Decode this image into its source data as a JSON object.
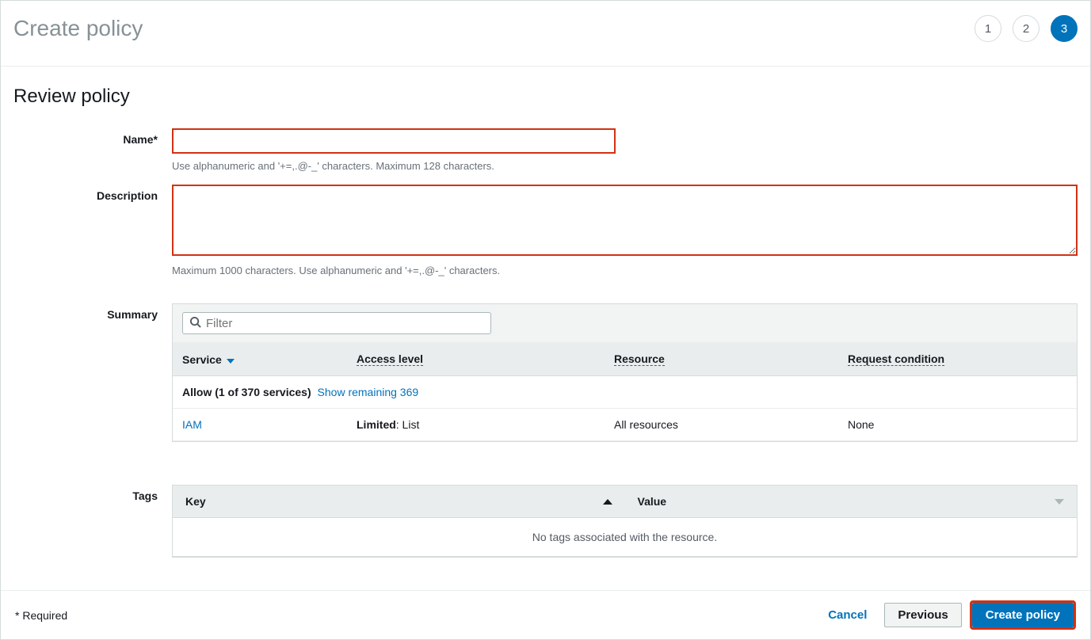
{
  "header": {
    "title": "Create policy",
    "steps": [
      "1",
      "2",
      "3"
    ],
    "active_step_index": 2
  },
  "section_title": "Review policy",
  "form": {
    "name_label": "Name*",
    "name_value": "",
    "name_hint": "Use alphanumeric and '+=,.@-_' characters. Maximum 128 characters.",
    "description_label": "Description",
    "description_value": "",
    "description_hint": "Maximum 1000 characters. Use alphanumeric and '+=,.@-_' characters."
  },
  "summary": {
    "label": "Summary",
    "filter_placeholder": "Filter",
    "columns": {
      "service": "Service",
      "access": "Access level",
      "resource": "Resource",
      "condition": "Request condition"
    },
    "allow_text": "Allow (1 of 370 services)",
    "show_remaining_text": "Show remaining 369",
    "rows": [
      {
        "service": "IAM",
        "access_bold": "Limited",
        "access_rest": ": List",
        "resource": "All resources",
        "condition": "None"
      }
    ]
  },
  "tags": {
    "label": "Tags",
    "key_col": "Key",
    "value_col": "Value",
    "empty_text": "No tags associated with the resource."
  },
  "footer": {
    "required": "* Required",
    "cancel": "Cancel",
    "previous": "Previous",
    "create": "Create policy"
  }
}
